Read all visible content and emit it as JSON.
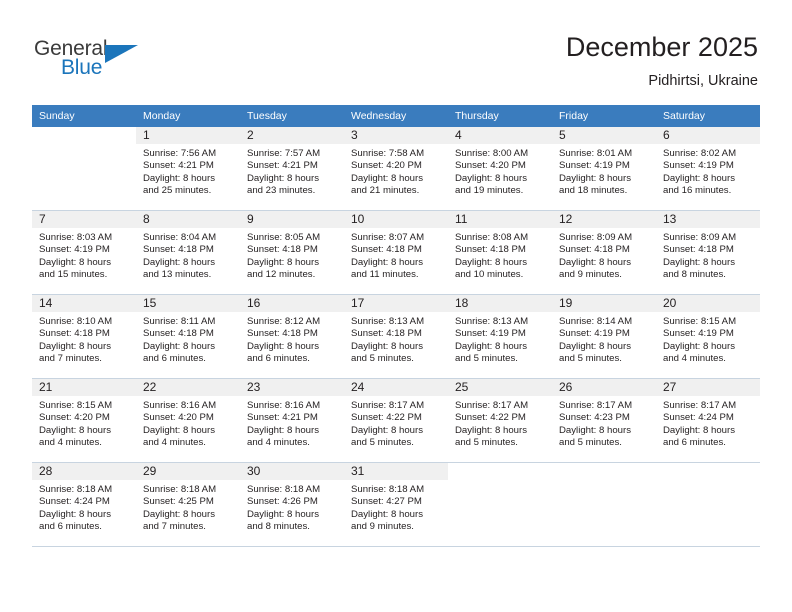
{
  "brand": {
    "name_part1": "General",
    "name_part2": "Blue",
    "logo_icon": "triangle-logo-icon",
    "accent_color": "#1b75bb"
  },
  "header": {
    "title": "December 2025",
    "subtitle": "Pidhirtsi, Ukraine"
  },
  "calendar": {
    "header_bg_color": "#3a7cbe",
    "daynum_band_color": "#f0f0f0",
    "weekdays": [
      "Sunday",
      "Monday",
      "Tuesday",
      "Wednesday",
      "Thursday",
      "Friday",
      "Saturday"
    ],
    "weeks": [
      [
        {
          "day": "",
          "sunrise": "",
          "sunset": "",
          "daylight_line1": "",
          "daylight_line2": ""
        },
        {
          "day": "1",
          "sunrise": "Sunrise: 7:56 AM",
          "sunset": "Sunset: 4:21 PM",
          "daylight_line1": "Daylight: 8 hours",
          "daylight_line2": "and 25 minutes."
        },
        {
          "day": "2",
          "sunrise": "Sunrise: 7:57 AM",
          "sunset": "Sunset: 4:21 PM",
          "daylight_line1": "Daylight: 8 hours",
          "daylight_line2": "and 23 minutes."
        },
        {
          "day": "3",
          "sunrise": "Sunrise: 7:58 AM",
          "sunset": "Sunset: 4:20 PM",
          "daylight_line1": "Daylight: 8 hours",
          "daylight_line2": "and 21 minutes."
        },
        {
          "day": "4",
          "sunrise": "Sunrise: 8:00 AM",
          "sunset": "Sunset: 4:20 PM",
          "daylight_line1": "Daylight: 8 hours",
          "daylight_line2": "and 19 minutes."
        },
        {
          "day": "5",
          "sunrise": "Sunrise: 8:01 AM",
          "sunset": "Sunset: 4:19 PM",
          "daylight_line1": "Daylight: 8 hours",
          "daylight_line2": "and 18 minutes."
        },
        {
          "day": "6",
          "sunrise": "Sunrise: 8:02 AM",
          "sunset": "Sunset: 4:19 PM",
          "daylight_line1": "Daylight: 8 hours",
          "daylight_line2": "and 16 minutes."
        }
      ],
      [
        {
          "day": "7",
          "sunrise": "Sunrise: 8:03 AM",
          "sunset": "Sunset: 4:19 PM",
          "daylight_line1": "Daylight: 8 hours",
          "daylight_line2": "and 15 minutes."
        },
        {
          "day": "8",
          "sunrise": "Sunrise: 8:04 AM",
          "sunset": "Sunset: 4:18 PM",
          "daylight_line1": "Daylight: 8 hours",
          "daylight_line2": "and 13 minutes."
        },
        {
          "day": "9",
          "sunrise": "Sunrise: 8:05 AM",
          "sunset": "Sunset: 4:18 PM",
          "daylight_line1": "Daylight: 8 hours",
          "daylight_line2": "and 12 minutes."
        },
        {
          "day": "10",
          "sunrise": "Sunrise: 8:07 AM",
          "sunset": "Sunset: 4:18 PM",
          "daylight_line1": "Daylight: 8 hours",
          "daylight_line2": "and 11 minutes."
        },
        {
          "day": "11",
          "sunrise": "Sunrise: 8:08 AM",
          "sunset": "Sunset: 4:18 PM",
          "daylight_line1": "Daylight: 8 hours",
          "daylight_line2": "and 10 minutes."
        },
        {
          "day": "12",
          "sunrise": "Sunrise: 8:09 AM",
          "sunset": "Sunset: 4:18 PM",
          "daylight_line1": "Daylight: 8 hours",
          "daylight_line2": "and 9 minutes."
        },
        {
          "day": "13",
          "sunrise": "Sunrise: 8:09 AM",
          "sunset": "Sunset: 4:18 PM",
          "daylight_line1": "Daylight: 8 hours",
          "daylight_line2": "and 8 minutes."
        }
      ],
      [
        {
          "day": "14",
          "sunrise": "Sunrise: 8:10 AM",
          "sunset": "Sunset: 4:18 PM",
          "daylight_line1": "Daylight: 8 hours",
          "daylight_line2": "and 7 minutes."
        },
        {
          "day": "15",
          "sunrise": "Sunrise: 8:11 AM",
          "sunset": "Sunset: 4:18 PM",
          "daylight_line1": "Daylight: 8 hours",
          "daylight_line2": "and 6 minutes."
        },
        {
          "day": "16",
          "sunrise": "Sunrise: 8:12 AM",
          "sunset": "Sunset: 4:18 PM",
          "daylight_line1": "Daylight: 8 hours",
          "daylight_line2": "and 6 minutes."
        },
        {
          "day": "17",
          "sunrise": "Sunrise: 8:13 AM",
          "sunset": "Sunset: 4:18 PM",
          "daylight_line1": "Daylight: 8 hours",
          "daylight_line2": "and 5 minutes."
        },
        {
          "day": "18",
          "sunrise": "Sunrise: 8:13 AM",
          "sunset": "Sunset: 4:19 PM",
          "daylight_line1": "Daylight: 8 hours",
          "daylight_line2": "and 5 minutes."
        },
        {
          "day": "19",
          "sunrise": "Sunrise: 8:14 AM",
          "sunset": "Sunset: 4:19 PM",
          "daylight_line1": "Daylight: 8 hours",
          "daylight_line2": "and 5 minutes."
        },
        {
          "day": "20",
          "sunrise": "Sunrise: 8:15 AM",
          "sunset": "Sunset: 4:19 PM",
          "daylight_line1": "Daylight: 8 hours",
          "daylight_line2": "and 4 minutes."
        }
      ],
      [
        {
          "day": "21",
          "sunrise": "Sunrise: 8:15 AM",
          "sunset": "Sunset: 4:20 PM",
          "daylight_line1": "Daylight: 8 hours",
          "daylight_line2": "and 4 minutes."
        },
        {
          "day": "22",
          "sunrise": "Sunrise: 8:16 AM",
          "sunset": "Sunset: 4:20 PM",
          "daylight_line1": "Daylight: 8 hours",
          "daylight_line2": "and 4 minutes."
        },
        {
          "day": "23",
          "sunrise": "Sunrise: 8:16 AM",
          "sunset": "Sunset: 4:21 PM",
          "daylight_line1": "Daylight: 8 hours",
          "daylight_line2": "and 4 minutes."
        },
        {
          "day": "24",
          "sunrise": "Sunrise: 8:17 AM",
          "sunset": "Sunset: 4:22 PM",
          "daylight_line1": "Daylight: 8 hours",
          "daylight_line2": "and 5 minutes."
        },
        {
          "day": "25",
          "sunrise": "Sunrise: 8:17 AM",
          "sunset": "Sunset: 4:22 PM",
          "daylight_line1": "Daylight: 8 hours",
          "daylight_line2": "and 5 minutes."
        },
        {
          "day": "26",
          "sunrise": "Sunrise: 8:17 AM",
          "sunset": "Sunset: 4:23 PM",
          "daylight_line1": "Daylight: 8 hours",
          "daylight_line2": "and 5 minutes."
        },
        {
          "day": "27",
          "sunrise": "Sunrise: 8:17 AM",
          "sunset": "Sunset: 4:24 PM",
          "daylight_line1": "Daylight: 8 hours",
          "daylight_line2": "and 6 minutes."
        }
      ],
      [
        {
          "day": "28",
          "sunrise": "Sunrise: 8:18 AM",
          "sunset": "Sunset: 4:24 PM",
          "daylight_line1": "Daylight: 8 hours",
          "daylight_line2": "and 6 minutes."
        },
        {
          "day": "29",
          "sunrise": "Sunrise: 8:18 AM",
          "sunset": "Sunset: 4:25 PM",
          "daylight_line1": "Daylight: 8 hours",
          "daylight_line2": "and 7 minutes."
        },
        {
          "day": "30",
          "sunrise": "Sunrise: 8:18 AM",
          "sunset": "Sunset: 4:26 PM",
          "daylight_line1": "Daylight: 8 hours",
          "daylight_line2": "and 8 minutes."
        },
        {
          "day": "31",
          "sunrise": "Sunrise: 8:18 AM",
          "sunset": "Sunset: 4:27 PM",
          "daylight_line1": "Daylight: 8 hours",
          "daylight_line2": "and 9 minutes."
        },
        {
          "day": "",
          "sunrise": "",
          "sunset": "",
          "daylight_line1": "",
          "daylight_line2": ""
        },
        {
          "day": "",
          "sunrise": "",
          "sunset": "",
          "daylight_line1": "",
          "daylight_line2": ""
        },
        {
          "day": "",
          "sunrise": "",
          "sunset": "",
          "daylight_line1": "",
          "daylight_line2": ""
        }
      ]
    ]
  }
}
